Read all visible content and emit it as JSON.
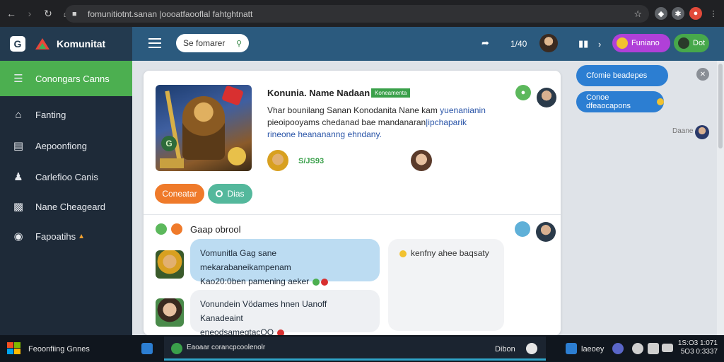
{
  "browser": {
    "url": "fomunitiotnt.sanan |oooatfaooflal fahtghtnatt"
  },
  "brand": {
    "name": "Komunitat"
  },
  "search": {
    "placeholder": "Se fomarer"
  },
  "header": {
    "counter": "1/40",
    "pill_purple_label": "Funiano",
    "pill_green_label": "Dot"
  },
  "sidebar": {
    "items": [
      {
        "label": "Conongars Canns",
        "icon": "chart-icon",
        "active": true
      },
      {
        "label": "Fanting",
        "icon": "home-icon"
      },
      {
        "label": "Aepoonfiong",
        "icon": "document-icon"
      },
      {
        "label": "Carlefioo Canis",
        "icon": "user-icon"
      },
      {
        "label": "Nane Cheageard",
        "icon": "image-icon"
      },
      {
        "label": "Fapoatihs",
        "icon": "globe-icon",
        "badge": "▲"
      }
    ]
  },
  "post": {
    "title": "Konunia. Name Nadaan",
    "tag": "Koneamenta",
    "body_line1": "Vhar bounilang Sanan Konodanita Nane kam",
    "body_line1_hl": " yuenanianin",
    "body_line2": "pieoipooyams  chedanad bae mandanaran",
    "body_line2_hl": "|ipchaparik",
    "body_line3": "rineone heanananng ehndany.",
    "score": "S/JS93",
    "btn_orange": "Coneatar",
    "btn_teal": "Dias"
  },
  "group": {
    "title": "Gaap obrool",
    "messages": [
      {
        "line1": "Vomunitla Gag sane mekarabaneikampenam",
        "line2": "Kao20:0ben pamening aeker"
      },
      {
        "line1": "Vonundein Vödames hnen Uanoff Kanadeaint",
        "line2": "eneodsamegtacOO"
      }
    ],
    "side_note": "kenfny ahee baqsaty"
  },
  "right_panel": {
    "pill1": "Cfomie beadepes",
    "pill2": "Conoe dfeaocapons",
    "label": "Daane"
  },
  "taskbar": {
    "app_label": "Feoonfiing Gnnes",
    "active_title": "Eaoaar corancpcoolenolr",
    "status1": "Dibon",
    "status2": "laeoey",
    "time_line1": "1S:O3 1:071",
    "time_line2": "5O3 0:3337"
  },
  "colors": {
    "header_bg": "#2b5a7e",
    "sidebar_bg": "#1e2a38",
    "active_green": "#4caf50",
    "accent_blue": "#2c7ed2",
    "orange": "#ef7a2a",
    "teal": "#54b89c"
  }
}
